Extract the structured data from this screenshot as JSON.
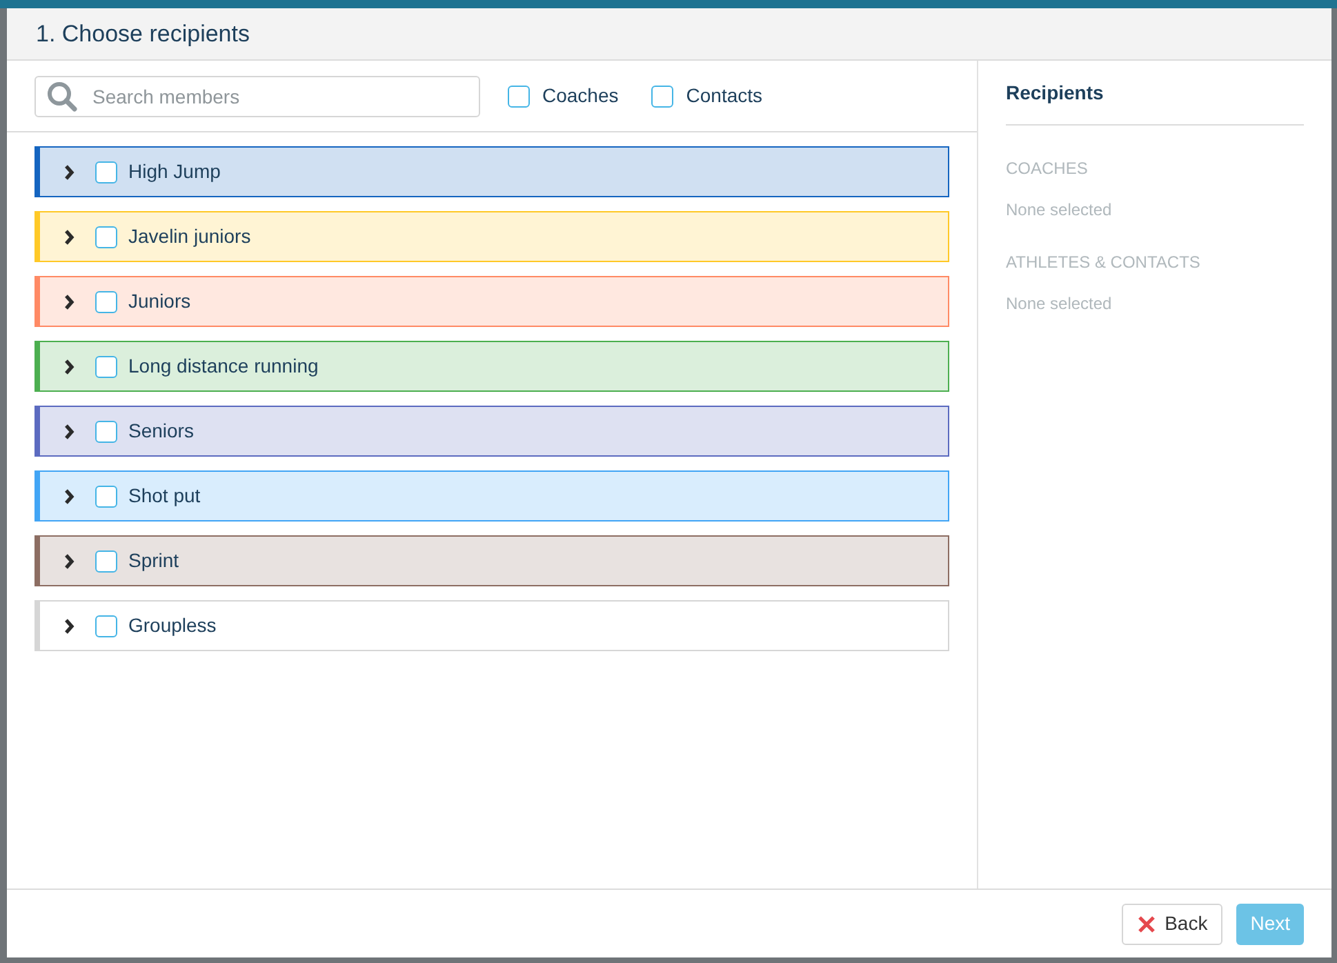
{
  "dialog": {
    "title": "1. Choose recipients"
  },
  "search": {
    "placeholder": "Search members"
  },
  "filters": [
    {
      "label": "Coaches",
      "checked": false
    },
    {
      "label": "Contacts",
      "checked": false
    }
  ],
  "groups": [
    {
      "name": "High Jump",
      "color": "#1565c0",
      "checked": false,
      "expanded": false
    },
    {
      "name": "Javelin juniors",
      "color": "#ffc928",
      "checked": false,
      "expanded": false
    },
    {
      "name": "Juniors",
      "color": "#ff8a65",
      "checked": false,
      "expanded": false
    },
    {
      "name": "Long distance running",
      "color": "#4caf50",
      "checked": false,
      "expanded": false
    },
    {
      "name": "Seniors",
      "color": "#5c6bc0",
      "checked": false,
      "expanded": false
    },
    {
      "name": "Shot put",
      "color": "#42a5f5",
      "checked": false,
      "expanded": false
    },
    {
      "name": "Sprint",
      "color": "#8d6e63",
      "checked": false,
      "expanded": false
    },
    {
      "name": "Groupless",
      "color": "#d6d6d6",
      "checked": false,
      "expanded": false
    }
  ],
  "recipients": {
    "title": "Recipients",
    "sections": [
      {
        "heading": "COACHES",
        "value": "None selected"
      },
      {
        "heading": "ATHLETES & CONTACTS",
        "value": "None selected"
      }
    ]
  },
  "buttons": [
    {
      "label": "Back",
      "kind": "back",
      "disabled": false
    },
    {
      "label": "Next",
      "kind": "next",
      "disabled": true
    }
  ]
}
